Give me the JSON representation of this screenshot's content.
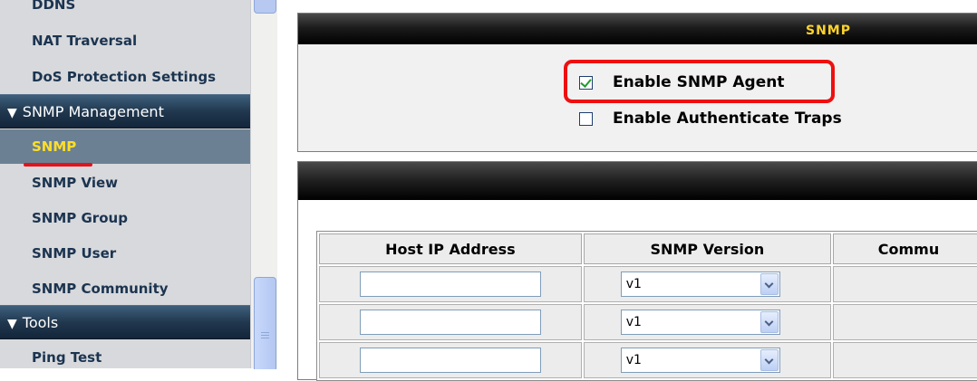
{
  "sidebar": {
    "items_top": [
      "DDNS",
      "NAT Traversal",
      "DoS Protection Settings"
    ],
    "snmp_header": "SNMP Management",
    "snmp_items": [
      "SNMP",
      "SNMP View",
      "SNMP Group",
      "SNMP User",
      "SNMP Community"
    ],
    "tools_header": "Tools",
    "tools_items": [
      "Ping Test"
    ],
    "collapse_glyph": "▼",
    "active_item": "SNMP",
    "active_color": "#ffde2a",
    "underline_color": "#e4121b"
  },
  "panel": {
    "title": "SNMP",
    "title_color": "#fcd32c",
    "checkboxes": [
      {
        "label": "Enable SNMP Agent",
        "checked": true
      },
      {
        "label": "Enable Authenticate Traps",
        "checked": false
      }
    ],
    "highlight_color": "#ee1010"
  },
  "hosts_table": {
    "columns": [
      "Host IP Address",
      "SNMP Version",
      "Commu"
    ],
    "rows": [
      {
        "ip": "",
        "version": "v1",
        "community": ""
      },
      {
        "ip": "",
        "version": "v1",
        "community": ""
      },
      {
        "ip": "",
        "version": "v1",
        "community": ""
      }
    ]
  }
}
